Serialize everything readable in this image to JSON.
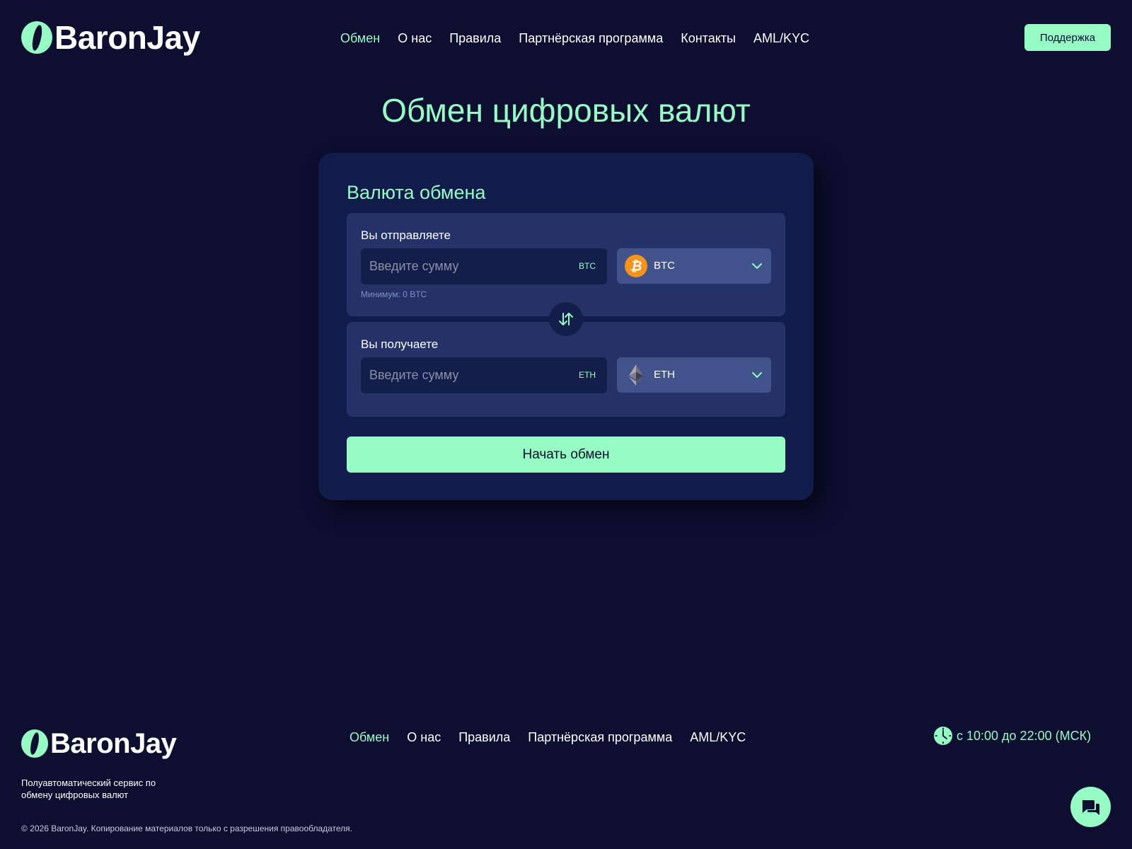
{
  "header": {
    "logo_text": "BaronJay",
    "nav": [
      {
        "label": "Обмен",
        "active": true
      },
      {
        "label": "О нас"
      },
      {
        "label": "Правила"
      },
      {
        "label": "Партнёрская программа"
      },
      {
        "label": "Контакты"
      },
      {
        "label": "AML/KYC"
      }
    ],
    "support_label": "Поддержка"
  },
  "main": {
    "title": "Обмен цифровых валют",
    "card_title": "Валюта обмена",
    "send": {
      "label": "Вы отправляете",
      "amount_placeholder": "Введите сумму",
      "unit": "BTC",
      "currency": "BTC",
      "currency_icon": "bitcoin-icon",
      "min_note": "Минимум: 0 BTC"
    },
    "receive": {
      "label": "Вы получаете",
      "amount_placeholder": "Введите сумму",
      "unit": "ETH",
      "currency": "ETH",
      "currency_icon": "ethereum-icon"
    },
    "swap_icon": "swap-arrows-icon",
    "start_label": "Начать обмен"
  },
  "footer": {
    "logo_text": "BaronJay",
    "tagline": "Полуавтоматический сервис по обмену цифровых валют",
    "nav": [
      {
        "label": "Обмен",
        "active": true
      },
      {
        "label": "О нас"
      },
      {
        "label": "Правила"
      },
      {
        "label": "Партнёрская программа"
      },
      {
        "label": "AML/KYC"
      }
    ],
    "hours": "с 10:00 до 22:00 (МСК)",
    "hours_icon": "clock-icon",
    "copyright": "© 2026 BaronJay. Копирование материалов только с разрешения правообладателя.",
    "chat_icon": "chat-icon"
  },
  "colors": {
    "background": "#0d0e30",
    "accent": "#97fbc4",
    "card": "#121c4a",
    "panel": "#243268",
    "select": "#42528a",
    "bitcoin": "#f7931a"
  }
}
